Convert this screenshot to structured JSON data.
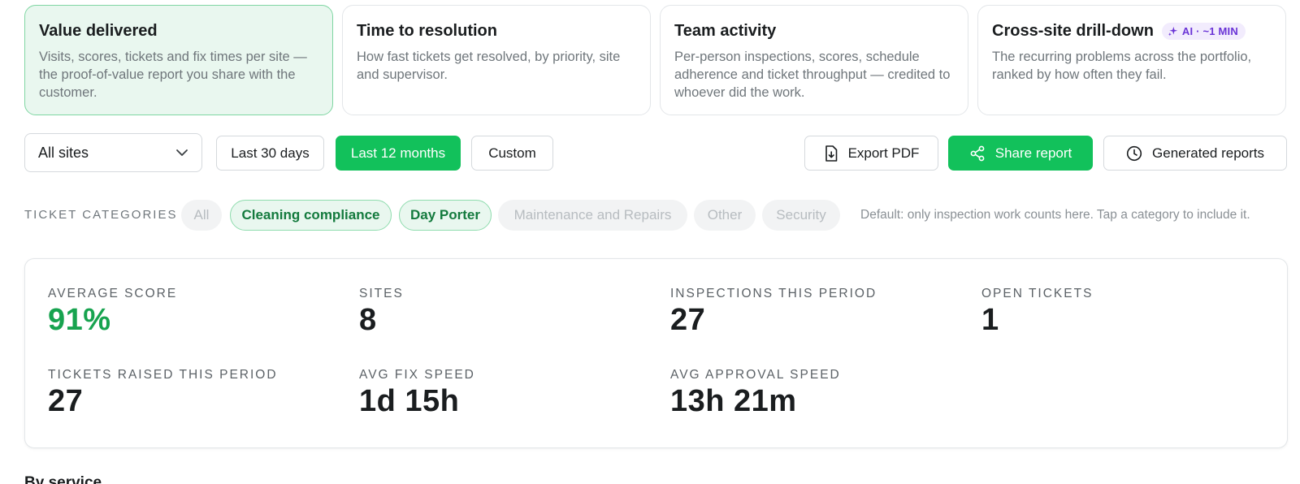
{
  "report_cards": [
    {
      "title": "Value delivered",
      "description": "Visits, scores, tickets and fix times per site — the proof-of-value report you share with the customer.",
      "active": true
    },
    {
      "title": "Time to resolution",
      "description": "How fast tickets get resolved, by priority, site and supervisor.",
      "active": false
    },
    {
      "title": "Team activity",
      "description": "Per-person inspections, scores, schedule adherence and ticket throughput — credited to whoever did the work.",
      "active": false
    },
    {
      "title": "Cross-site drill-down",
      "badge": "AI · ~1 MIN",
      "description": "The recurring problems across the portfolio, ranked by how often they fail.",
      "active": false
    }
  ],
  "filters": {
    "site_select": {
      "value": "All sites"
    },
    "date_ranges": [
      {
        "label": "Last 30 days",
        "selected": false
      },
      {
        "label": "Last 12 months",
        "selected": true
      },
      {
        "label": "Custom",
        "selected": false
      }
    ]
  },
  "actions": {
    "export_pdf": "Export PDF",
    "share_report": "Share report",
    "generated_reports": "Generated reports"
  },
  "ticket_categories": {
    "label": "TICKET CATEGORIES",
    "chips": [
      {
        "label": "All",
        "selected": false
      },
      {
        "label": "Cleaning compliance",
        "selected": true
      },
      {
        "label": "Day Porter",
        "selected": true
      },
      {
        "label": "Maintenance and Repairs",
        "selected": false
      },
      {
        "label": "Other",
        "selected": false
      },
      {
        "label": "Security",
        "selected": false
      }
    ],
    "hint": "Default: only inspection work counts here. Tap a category to include it."
  },
  "metrics": [
    {
      "label": "AVERAGE SCORE",
      "value": "91%",
      "highlight": true
    },
    {
      "label": "SITES",
      "value": "8"
    },
    {
      "label": "INSPECTIONS THIS PERIOD",
      "value": "27"
    },
    {
      "label": "OPEN TICKETS",
      "value": "1"
    },
    {
      "label": "TICKETS RAISED THIS PERIOD",
      "value": "27"
    },
    {
      "label": "AVG FIX SPEED",
      "value": "1d 15h"
    },
    {
      "label": "AVG APPROVAL SPEED",
      "value": "13h 21m"
    }
  ],
  "section_heading": "By service",
  "colors": {
    "accent": "#12c15b",
    "accent_soft": "#e9f7ef",
    "score": "#17a34f",
    "ai_badge": "#6a34d6"
  }
}
